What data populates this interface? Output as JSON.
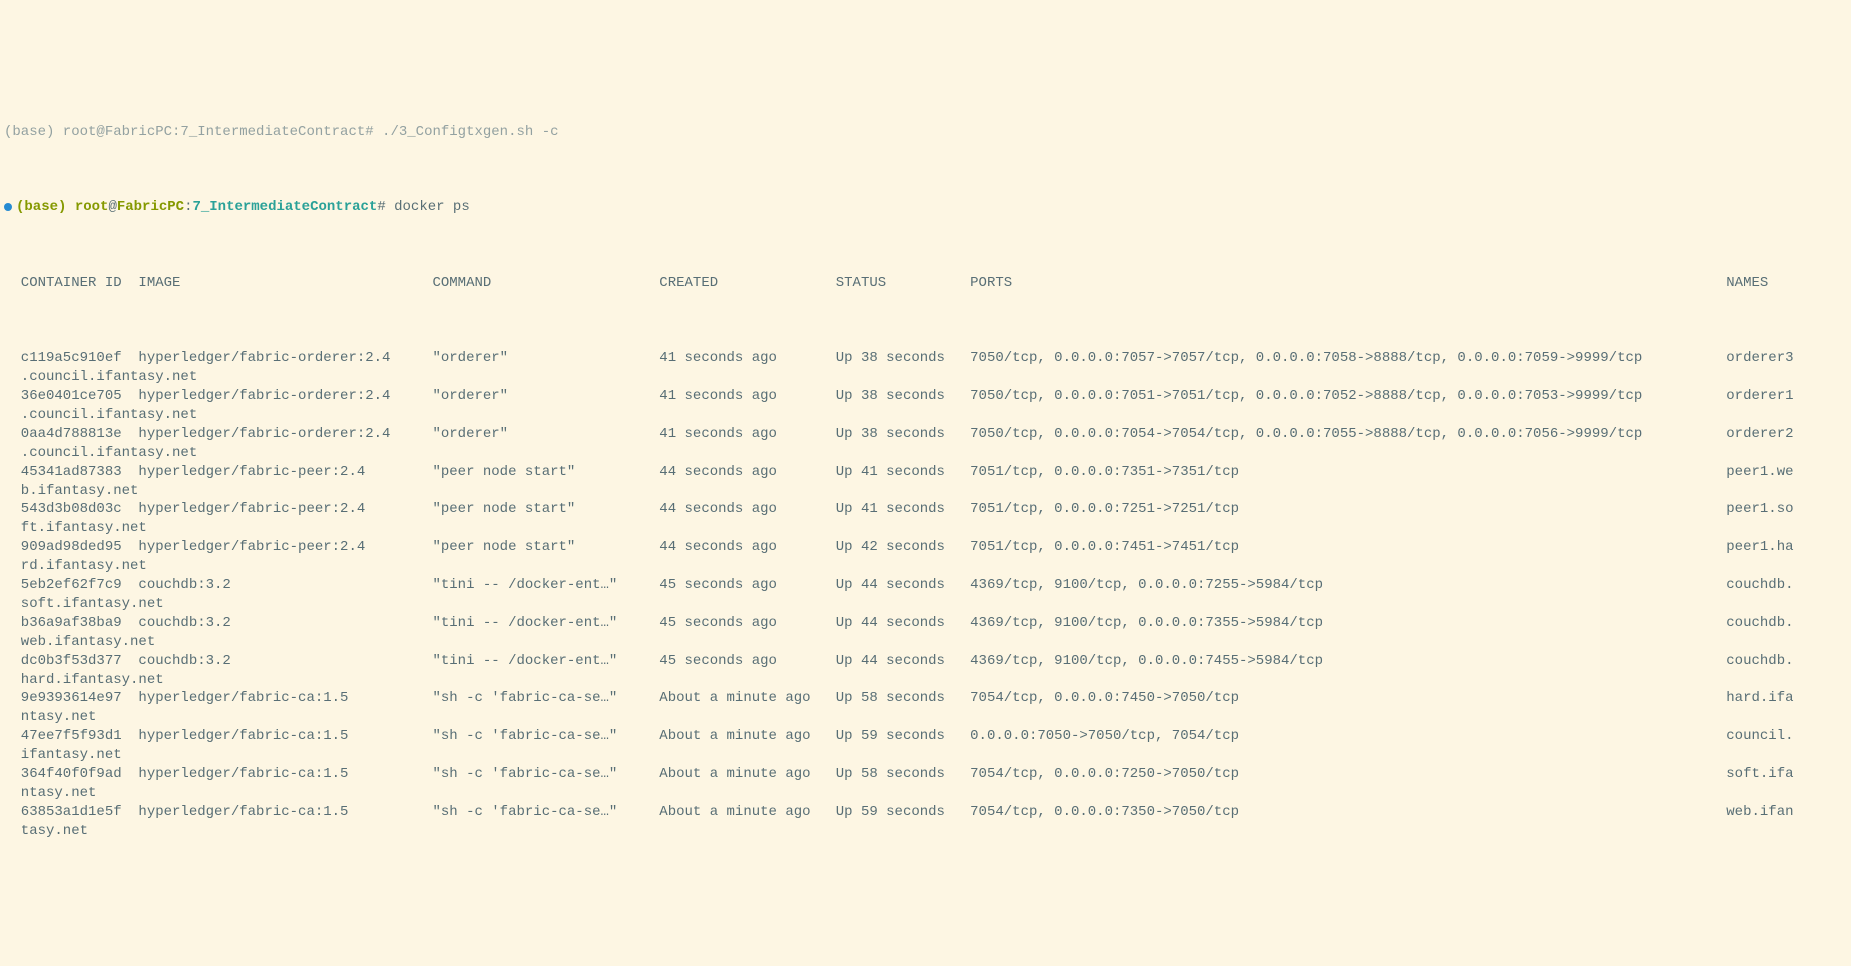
{
  "prompt_line0": "(base) root@FabricPC:7_IntermediateContract# ./3_Configtxgen.sh -c",
  "prompt": {
    "env": "(base)",
    "user": "root",
    "host": "FabricPC",
    "cwd": "7_IntermediateContract",
    "symbol": "#",
    "command": "docker ps"
  },
  "headers": {
    "id": "CONTAINER ID",
    "image": "IMAGE",
    "command": "COMMAND",
    "created": "CREATED",
    "status": "STATUS",
    "ports": "PORTS",
    "names": "NAMES"
  },
  "rows": [
    {
      "id": "c119a5c910ef",
      "image": "hyperledger/fabric-orderer:2.4",
      "command": "\"orderer\"",
      "created": "41 seconds ago",
      "status": "Up 38 seconds",
      "ports": "7050/tcp, 0.0.0.0:7057->7057/tcp, 0.0.0.0:7058->8888/tcp, 0.0.0.0:7059->9999/tcp",
      "names": "orderer3",
      "extra": ".council.ifantasy.net"
    },
    {
      "id": "36e0401ce705",
      "image": "hyperledger/fabric-orderer:2.4",
      "command": "\"orderer\"",
      "created": "41 seconds ago",
      "status": "Up 38 seconds",
      "ports": "7050/tcp, 0.0.0.0:7051->7051/tcp, 0.0.0.0:7052->8888/tcp, 0.0.0.0:7053->9999/tcp",
      "names": "orderer1",
      "extra": ".council.ifantasy.net"
    },
    {
      "id": "0aa4d788813e",
      "image": "hyperledger/fabric-orderer:2.4",
      "command": "\"orderer\"",
      "created": "41 seconds ago",
      "status": "Up 38 seconds",
      "ports": "7050/tcp, 0.0.0.0:7054->7054/tcp, 0.0.0.0:7055->8888/tcp, 0.0.0.0:7056->9999/tcp",
      "names": "orderer2",
      "extra": ".council.ifantasy.net"
    },
    {
      "id": "45341ad87383",
      "image": "hyperledger/fabric-peer:2.4",
      "command": "\"peer node start\"",
      "created": "44 seconds ago",
      "status": "Up 41 seconds",
      "ports": "7051/tcp, 0.0.0.0:7351->7351/tcp",
      "names": "peer1.we",
      "extra": "b.ifantasy.net"
    },
    {
      "id": "543d3b08d03c",
      "image": "hyperledger/fabric-peer:2.4",
      "command": "\"peer node start\"",
      "created": "44 seconds ago",
      "status": "Up 41 seconds",
      "ports": "7051/tcp, 0.0.0.0:7251->7251/tcp",
      "names": "peer1.so",
      "extra": "ft.ifantasy.net"
    },
    {
      "id": "909ad98ded95",
      "image": "hyperledger/fabric-peer:2.4",
      "command": "\"peer node start\"",
      "created": "44 seconds ago",
      "status": "Up 42 seconds",
      "ports": "7051/tcp, 0.0.0.0:7451->7451/tcp",
      "names": "peer1.ha",
      "extra": "rd.ifantasy.net"
    },
    {
      "id": "5eb2ef62f7c9",
      "image": "couchdb:3.2",
      "command": "\"tini -- /docker-ent…\"",
      "created": "45 seconds ago",
      "status": "Up 44 seconds",
      "ports": "4369/tcp, 9100/tcp, 0.0.0.0:7255->5984/tcp",
      "names": "couchdb.",
      "extra": "soft.ifantasy.net"
    },
    {
      "id": "b36a9af38ba9",
      "image": "couchdb:3.2",
      "command": "\"tini -- /docker-ent…\"",
      "created": "45 seconds ago",
      "status": "Up 44 seconds",
      "ports": "4369/tcp, 9100/tcp, 0.0.0.0:7355->5984/tcp",
      "names": "couchdb.",
      "extra": "web.ifantasy.net"
    },
    {
      "id": "dc0b3f53d377",
      "image": "couchdb:3.2",
      "command": "\"tini -- /docker-ent…\"",
      "created": "45 seconds ago",
      "status": "Up 44 seconds",
      "ports": "4369/tcp, 9100/tcp, 0.0.0.0:7455->5984/tcp",
      "names": "couchdb.",
      "extra": "hard.ifantasy.net"
    },
    {
      "id": "9e9393614e97",
      "image": "hyperledger/fabric-ca:1.5",
      "command": "\"sh -c 'fabric-ca-se…\"",
      "created": "About a minute ago",
      "status": "Up 58 seconds",
      "ports": "7054/tcp, 0.0.0.0:7450->7050/tcp",
      "names": "hard.ifa",
      "extra": "ntasy.net"
    },
    {
      "id": "47ee7f5f93d1",
      "image": "hyperledger/fabric-ca:1.5",
      "command": "\"sh -c 'fabric-ca-se…\"",
      "created": "About a minute ago",
      "status": "Up 59 seconds",
      "ports": "0.0.0.0:7050->7050/tcp, 7054/tcp",
      "names": "council.",
      "extra": "ifantasy.net"
    },
    {
      "id": "364f40f0f9ad",
      "image": "hyperledger/fabric-ca:1.5",
      "command": "\"sh -c 'fabric-ca-se…\"",
      "created": "About a minute ago",
      "status": "Up 58 seconds",
      "ports": "7054/tcp, 0.0.0.0:7250->7050/tcp",
      "names": "soft.ifa",
      "extra": "ntasy.net"
    },
    {
      "id": "63853a1d1e5f",
      "image": "hyperledger/fabric-ca:1.5",
      "command": "\"sh -c 'fabric-ca-se…\"",
      "created": "About a minute ago",
      "status": "Up 59 seconds",
      "ports": "7054/tcp, 0.0.0.0:7350->7050/tcp",
      "names": "web.ifan",
      "extra": "tasy.net"
    }
  ],
  "cols": {
    "id": 14,
    "image": 35,
    "command": 27,
    "created": 21,
    "status": 16,
    "ports": 90,
    "names": 0
  }
}
